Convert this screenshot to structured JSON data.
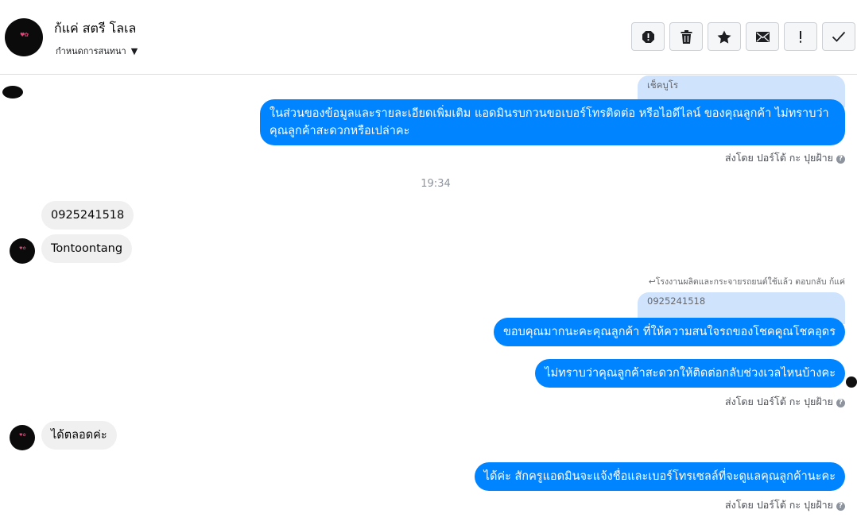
{
  "header": {
    "contact_name": "ก้แค่ สตรี โลเล",
    "conversation_settings": "กำหนดการสนทนา",
    "toolbar": [
      {
        "name": "report-spam-button",
        "icon": "alert-circle-icon"
      },
      {
        "name": "delete-button",
        "icon": "trash-icon"
      },
      {
        "name": "star-button",
        "icon": "star-icon"
      },
      {
        "name": "mark-unread-button",
        "icon": "envelope-icon"
      },
      {
        "name": "important-button",
        "icon": "exclamation-icon"
      },
      {
        "name": "done-button",
        "icon": "check-icon"
      }
    ]
  },
  "messages": {
    "quote1": "เช็คบูโร",
    "out1": "ในส่วนของข้อมูลและรายละเอียดเพิ่มเติม แอดมินรบกวนขอเบอร์โทรติดต่อ หรือไอดีไลน์ ของคุณลูกค้า ไม่ทราบว่าคุณลูกค้าสะดวกหรือเปล่าคะ",
    "sent_by": "ส่งโดย ปอร์โต้ กะ ปุยฝ้าย",
    "timestamp": "19:34",
    "in1": "0925241518",
    "in2": "Tontoontang",
    "reply_note": "โรงงานผลิตและกระจายรถยนต์ใช้แล้ว ตอบกลับ ก้แค่",
    "quote2": "0925241518",
    "out2": "ขอบคุณมากนะคะคุณลูกค้า ที่ให้ความสนใจรถของโชคคูณโชคอุดร",
    "out3": "ไม่ทราบว่าคุณลูกค้าสะดวกให้ติดต่อกลับช่วงเวลไหนบ้างคะ",
    "in3": "ได้ตลอดค่ะ",
    "out4": "ได้ค่ะ สักครูแอดมินจะแจ้งชื่อและเบอร์โทรเซลล์ที่จะดูแลคุณลูกค้านะคะ"
  },
  "colors": {
    "outgoing_bubble": "#0084ff",
    "incoming_bubble": "#f0f0f0",
    "quote_bubble": "#cfe3fd"
  }
}
